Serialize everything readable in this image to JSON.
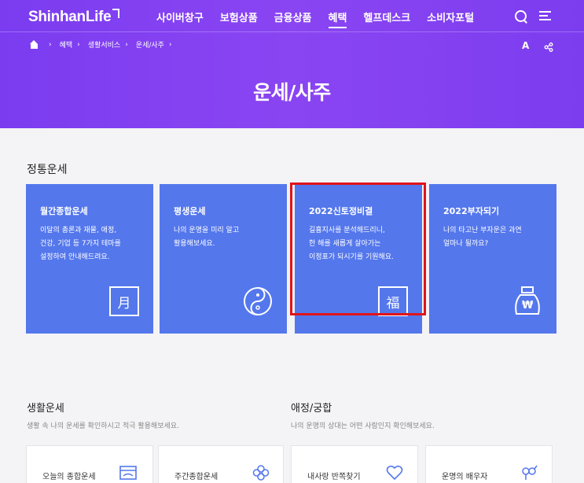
{
  "header": {
    "logo": "ShinhanLife",
    "nav": [
      "사이버창구",
      "보험상품",
      "금융상품",
      "혜택",
      "헬프데스크",
      "소비자포털"
    ],
    "active_nav": "혜택"
  },
  "breadcrumb": [
    "혜택",
    "생활서비스",
    "운세/사주"
  ],
  "font_size_label": "A",
  "page_title": "운세/사주",
  "fortune_section": {
    "title": "정통운세",
    "cards": [
      {
        "title": "월간종합운세",
        "desc": "이달의 총론과 재물, 애정,\n건강, 기업 등 7가지 테마를\n설정하여 안내해드려요.",
        "icon_glyph": "月"
      },
      {
        "title": "평생운세",
        "desc": "나의 운명을 미리 알고\n활용해보세요.",
        "icon_glyph": ""
      },
      {
        "title": "2022신토정비결",
        "desc": "길흉지사를 분석해드리니,\n한 해를 새롭게 살아가는\n이정표가 되시기를 기원해요.",
        "icon_glyph": "福"
      },
      {
        "title": "2022부자되기",
        "desc": "나의 타고난 부자운은 과연\n얼마나 될까요?",
        "icon_glyph": "₩"
      }
    ]
  },
  "life_section": {
    "title": "생활운세",
    "subtitle": "생활 속 나의 운세를 확인하시고 적극 활용해보세요.",
    "cards": [
      {
        "label": "오늘의 종합운세"
      },
      {
        "label": "주간종합운세"
      }
    ]
  },
  "love_section": {
    "title": "애정/궁합",
    "subtitle": "나의 운명의 상대는 어떤 사람인지 확인해보세요.",
    "cards": [
      {
        "label": "내사랑 반쪽찾기"
      },
      {
        "label": "운명의 배우자"
      }
    ]
  },
  "colors": {
    "hero": "#7b3cf0",
    "card": "#5477ec",
    "highlight": "#e0141b"
  }
}
